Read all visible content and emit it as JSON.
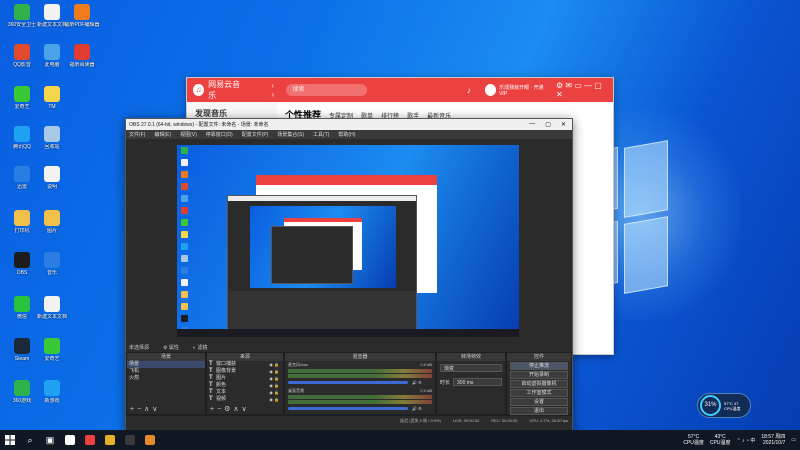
{
  "desktop": {
    "icons": [
      {
        "label": "360安全卫士",
        "color": "#2fb24a"
      },
      {
        "label": "新建文本文档",
        "color": "#f2f2f2"
      },
      {
        "label": "福昕PDF编辑器",
        "color": "#f07b1c"
      },
      {
        "label": "QQ影音",
        "color": "#e14b2d"
      },
      {
        "label": "此电脑",
        "color": "#4aa3e8"
      },
      {
        "label": "福昕阅读器",
        "color": "#e03c2f"
      },
      {
        "label": "爱奇艺",
        "color": "#37c936"
      },
      {
        "label": "TM",
        "color": "#f5d64b"
      },
      {
        "label": "腾讯QQ",
        "color": "#1ea2f1"
      },
      {
        "label": "回收站",
        "color": "#a8c8e8"
      },
      {
        "label": "迅雷",
        "color": "#2a7de1"
      },
      {
        "label": "说明",
        "color": "#f2f2f2"
      },
      {
        "label": "打印机",
        "color": "#f2c14b"
      },
      {
        "label": "图片",
        "color": "#f2c14b"
      },
      {
        "label": "OBS",
        "color": "#1c1c1c"
      },
      {
        "label": "音乐",
        "color": "#2b7de1"
      },
      {
        "label": "微信",
        "color": "#28c23c"
      },
      {
        "label": "新建文本文档",
        "color": "#f2f2f2"
      },
      {
        "label": "Steam",
        "color": "#1b2838"
      },
      {
        "label": "爱奇艺",
        "color": "#37c936"
      },
      {
        "label": "360游戏",
        "color": "#2fb24a"
      },
      {
        "label": "新游戏",
        "color": "#1ea2f1"
      }
    ]
  },
  "netease": {
    "app_title": "网易云音乐",
    "search_placeholder": "搜索",
    "user_name": "乐成我就开眼 · 开通VIP",
    "sidebar_title": "发现音乐",
    "tabs": [
      "个性推荐",
      "专属定制",
      "歌单",
      "排行榜",
      "歌手",
      "最新音乐"
    ],
    "brand_color": "#ec4141"
  },
  "obs": {
    "window_title": "OBS 27.0.1 (64-bit, windows) - 配置文件: 未命名 - 场景: 未命名",
    "menu": [
      "文件(F)",
      "编辑(E)",
      "视图(V)",
      "停靠窗口(D)",
      "配置文件(P)",
      "场景集合(S)",
      "工具(T)",
      "帮助(H)"
    ],
    "no_source": "未选择源",
    "props_label": "属性",
    "filters_label": "滤镜",
    "docks": {
      "scenes": {
        "title": "场景",
        "items": [
          "场景",
          "飞机",
          "火箭"
        ]
      },
      "sources": {
        "title": "来源",
        "items": [
          "窗口捕获",
          "图像背景",
          "图片",
          "颜色",
          "文本",
          "视频"
        ]
      },
      "mixer": {
        "title": "混音器",
        "tracks": [
          {
            "name": "麦克风/Aux",
            "db": "0.0 dB"
          },
          {
            "name": "桌面音频",
            "db": "0.0 dB"
          }
        ]
      },
      "transitions": {
        "title": "转场特效",
        "type": "渐变",
        "duration_label": "时长",
        "duration": "300 ms"
      },
      "controls": {
        "title": "控件",
        "buttons": [
          "停止推流",
          "开始录制",
          "启动虚拟摄像机",
          "工作室模式",
          "设置",
          "退出"
        ]
      }
    },
    "footer": {
      "live": "LIVE: 00:00:00",
      "rec": "REC: 00:00:00",
      "cpu": "CPU: 0.7%, 30.00 fps",
      "dropped": "延迟 (丢失 0 帧 / 0.0%)"
    }
  },
  "perf_widget": {
    "value": "31%",
    "temp": "57°C 47",
    "label": "CPU温度"
  },
  "taskbar": {
    "apps": [
      {
        "name": "search-icon",
        "color": "#ffffff"
      },
      {
        "name": "netease-app",
        "color": "#ec4141"
      },
      {
        "name": "chrome-app",
        "color": "#e5b12b"
      },
      {
        "name": "obs-app",
        "color": "#3a3a3a"
      },
      {
        "name": "file-app",
        "color": "#e58a2b"
      }
    ],
    "temp1": "57°C",
    "temp1_label": "CPU温度",
    "temp2": "43°C",
    "temp2_label": "CPU温度",
    "time": "18:57 周四",
    "date": "2021/10/7"
  }
}
